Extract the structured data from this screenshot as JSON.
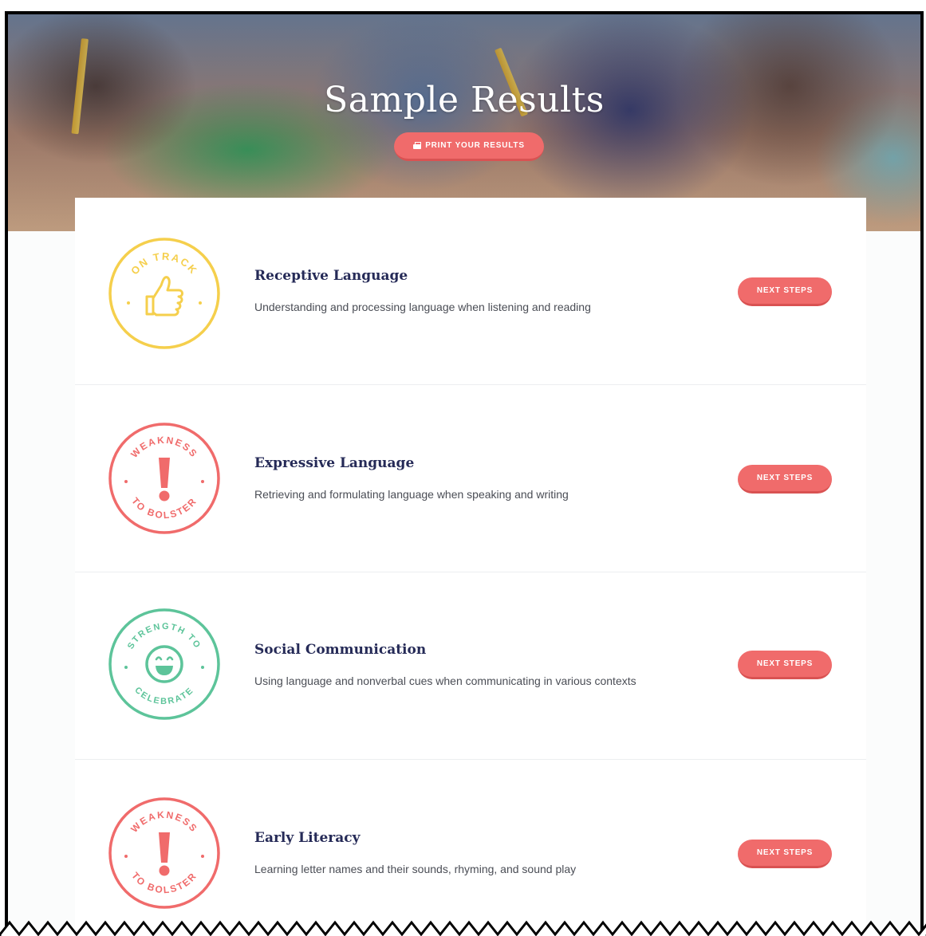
{
  "hero": {
    "title": "Sample Results",
    "print_label": "PRINT YOUR RESULTS",
    "print_icon": "printer-icon"
  },
  "colors": {
    "accent": "#f06b6b",
    "title": "#252a57",
    "on_track": "#f5cf4c",
    "weakness": "#f06b6b",
    "strength": "#5dc49a"
  },
  "results": [
    {
      "badge_text_top": "ON TRACK",
      "badge_text_bottom": "",
      "badge_icon": "thumbs-up-icon",
      "badge_color": "#f5cf4c",
      "title": "Receptive Language",
      "description": "Understanding and processing language when listening and reading",
      "button_label": "NEXT STEPS"
    },
    {
      "badge_text_top": "WEAKNESS",
      "badge_text_bottom": "TO BOLSTER",
      "badge_icon": "exclamation-icon",
      "badge_color": "#f06b6b",
      "title": "Expressive Language",
      "description": "Retrieving and formulating language when speaking and writing",
      "button_label": "NEXT STEPS"
    },
    {
      "badge_text_top": "STRENGTH TO",
      "badge_text_bottom": "CELEBRATE",
      "badge_icon": "smiley-icon",
      "badge_color": "#5dc49a",
      "title": "Social Communication",
      "description": "Using language and nonverbal cues when communicating in various contexts",
      "button_label": "NEXT STEPS"
    },
    {
      "badge_text_top": "WEAKNESS",
      "badge_text_bottom": "TO BOLSTER",
      "badge_icon": "exclamation-icon",
      "badge_color": "#f06b6b",
      "title": "Early Literacy",
      "description": "Learning letter names and their sounds, rhyming, and sound play",
      "button_label": "NEXT STEPS"
    }
  ]
}
